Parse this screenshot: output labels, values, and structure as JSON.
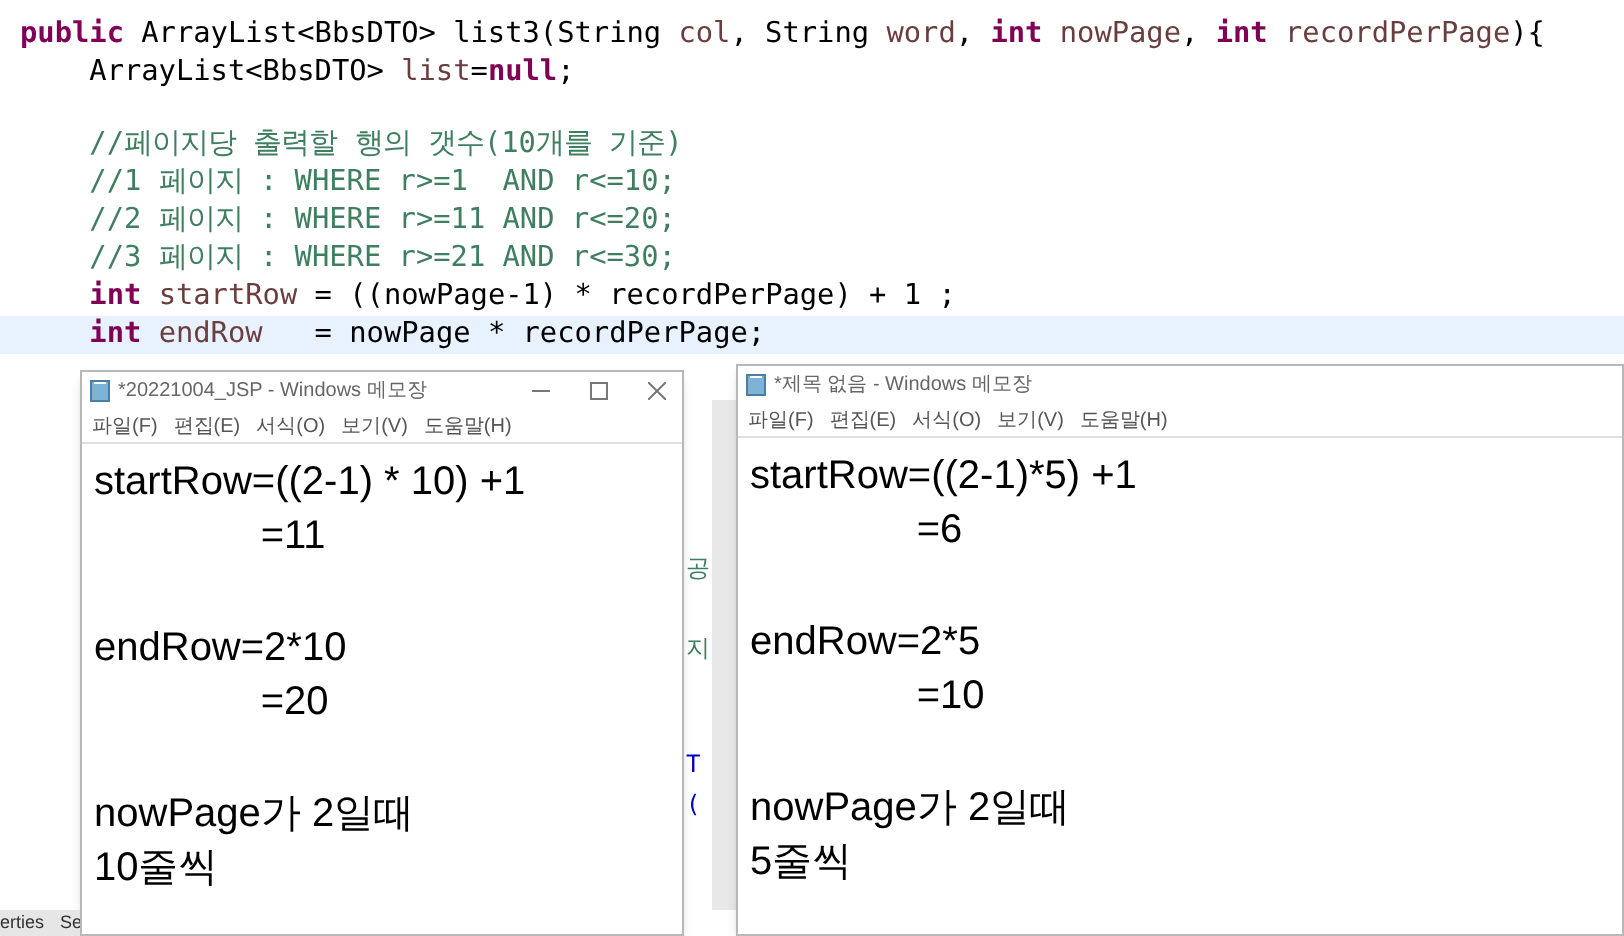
{
  "editor": {
    "lines": [
      {
        "current": false,
        "segments": [
          {
            "kind": "kw",
            "text": "public"
          },
          {
            "kind": "plain",
            "text": " ArrayList<BbsDTO> list3(String "
          },
          {
            "kind": "var",
            "text": "col"
          },
          {
            "kind": "plain",
            "text": ", String "
          },
          {
            "kind": "var",
            "text": "word"
          },
          {
            "kind": "plain",
            "text": ", "
          },
          {
            "kind": "kw",
            "text": "int"
          },
          {
            "kind": "var",
            "text": " nowPage"
          },
          {
            "kind": "plain",
            "text": ", "
          },
          {
            "kind": "kw",
            "text": "int"
          },
          {
            "kind": "var",
            "text": " recordPerPage"
          },
          {
            "kind": "plain",
            "text": "){"
          }
        ]
      },
      {
        "current": false,
        "segments": [
          {
            "kind": "plain",
            "text": "    ArrayList<BbsDTO> "
          },
          {
            "kind": "var",
            "text": "list"
          },
          {
            "kind": "plain",
            "text": "="
          },
          {
            "kind": "kw",
            "text": "null"
          },
          {
            "kind": "plain",
            "text": ";"
          }
        ]
      },
      {
        "gap_before": true,
        "current": false,
        "segments": [
          {
            "kind": "cmt",
            "text": "    //페이지당 출력할 행의 갯수(10개를 기준)"
          }
        ]
      },
      {
        "current": false,
        "segments": [
          {
            "kind": "cmt",
            "text": "    //1 페이지 : WHERE r>=1  AND r<=10;"
          }
        ]
      },
      {
        "current": false,
        "segments": [
          {
            "kind": "cmt",
            "text": "    //2 페이지 : WHERE r>=11 AND r<=20;"
          }
        ]
      },
      {
        "current": false,
        "segments": [
          {
            "kind": "cmt",
            "text": "    //3 페이지 : WHERE r>=21 AND r<=30;"
          }
        ]
      },
      {
        "current": false,
        "segments": [
          {
            "kind": "kw",
            "text": "    int"
          },
          {
            "kind": "var",
            "text": " startRow"
          },
          {
            "kind": "plain",
            "text": " = ((nowPage-1) * recordPerPage) + 1 ;"
          }
        ]
      },
      {
        "current": true,
        "segments": [
          {
            "kind": "kw",
            "text": "    int"
          },
          {
            "kind": "var",
            "text": " endRow"
          },
          {
            "kind": "plain",
            "text": "   = nowPage * recordPerPage;"
          }
        ]
      }
    ],
    "fragments": [
      {
        "kind": "cmt",
        "text": "공"
      },
      {
        "kind": "cmt",
        "text": "지"
      },
      {
        "kind": "code",
        "text": "T"
      },
      {
        "kind": "code",
        "text": "("
      }
    ],
    "bottom_tabs": [
      "erties",
      "Se"
    ]
  },
  "notepads": [
    {
      "title": "*20221004_JSP - Windows 메모장",
      "menu": [
        "파일(F)",
        "편집(E)",
        "서식(O)",
        "보기(V)",
        "도움말(H)"
      ],
      "window_buttons": true,
      "paragraphs": [
        [
          "startRow=((2-1) * 10) +1",
          "               =11"
        ],
        [
          "endRow=2*10",
          "               =20"
        ],
        [
          "nowPage가 2일때",
          "10줄씩"
        ]
      ]
    },
    {
      "title": "*제목 없음 - Windows 메모장",
      "menu": [
        "파일(F)",
        "편집(E)",
        "서식(O)",
        "보기(V)",
        "도움말(H)"
      ],
      "window_buttons": false,
      "paragraphs": [
        [
          "startRow=((2-1)*5) +1",
          "               =6"
        ],
        [
          "endRow=2*5",
          "               =10"
        ],
        [
          "nowPage가 2일때",
          "5줄씩"
        ]
      ]
    }
  ]
}
